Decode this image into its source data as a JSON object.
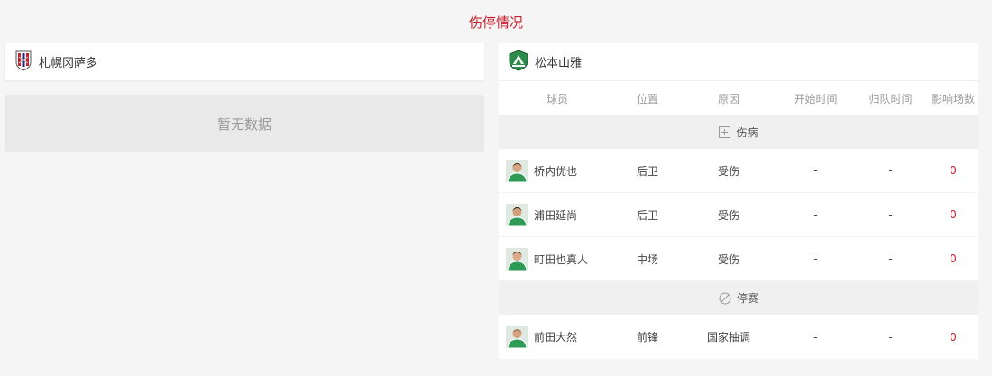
{
  "page_title": "伤停情况",
  "home": {
    "team_name": "札幌冈萨多",
    "logo_icon": "consadole-crest-icon",
    "empty_text": "暂无数据"
  },
  "away": {
    "team_name": "松本山雅",
    "logo_icon": "yamaga-crest-icon",
    "columns": [
      "球员",
      "位置",
      "原因",
      "开始时间",
      "归队时间",
      "影响场数"
    ],
    "sections": [
      {
        "title": "伤病",
        "icon": "plus-square-icon",
        "rows": [
          {
            "name": "桥内优也",
            "position": "后卫",
            "reason": "受伤",
            "start": "-",
            "return": "-",
            "games": "0"
          },
          {
            "name": "浦田延尚",
            "position": "后卫",
            "reason": "受伤",
            "start": "-",
            "return": "-",
            "games": "0"
          },
          {
            "name": "町田也真人",
            "position": "中场",
            "reason": "受伤",
            "start": "-",
            "return": "-",
            "games": "0"
          }
        ]
      },
      {
        "title": "停赛",
        "icon": "ban-circle-icon",
        "rows": [
          {
            "name": "前田大然",
            "position": "前锋",
            "reason": "国家抽调",
            "start": "-",
            "return": "-",
            "games": "0"
          }
        ]
      }
    ]
  },
  "colors": {
    "accent": "#c8202c",
    "section_bg": "#f0f0f0",
    "empty_bg": "#e9e9ea"
  }
}
